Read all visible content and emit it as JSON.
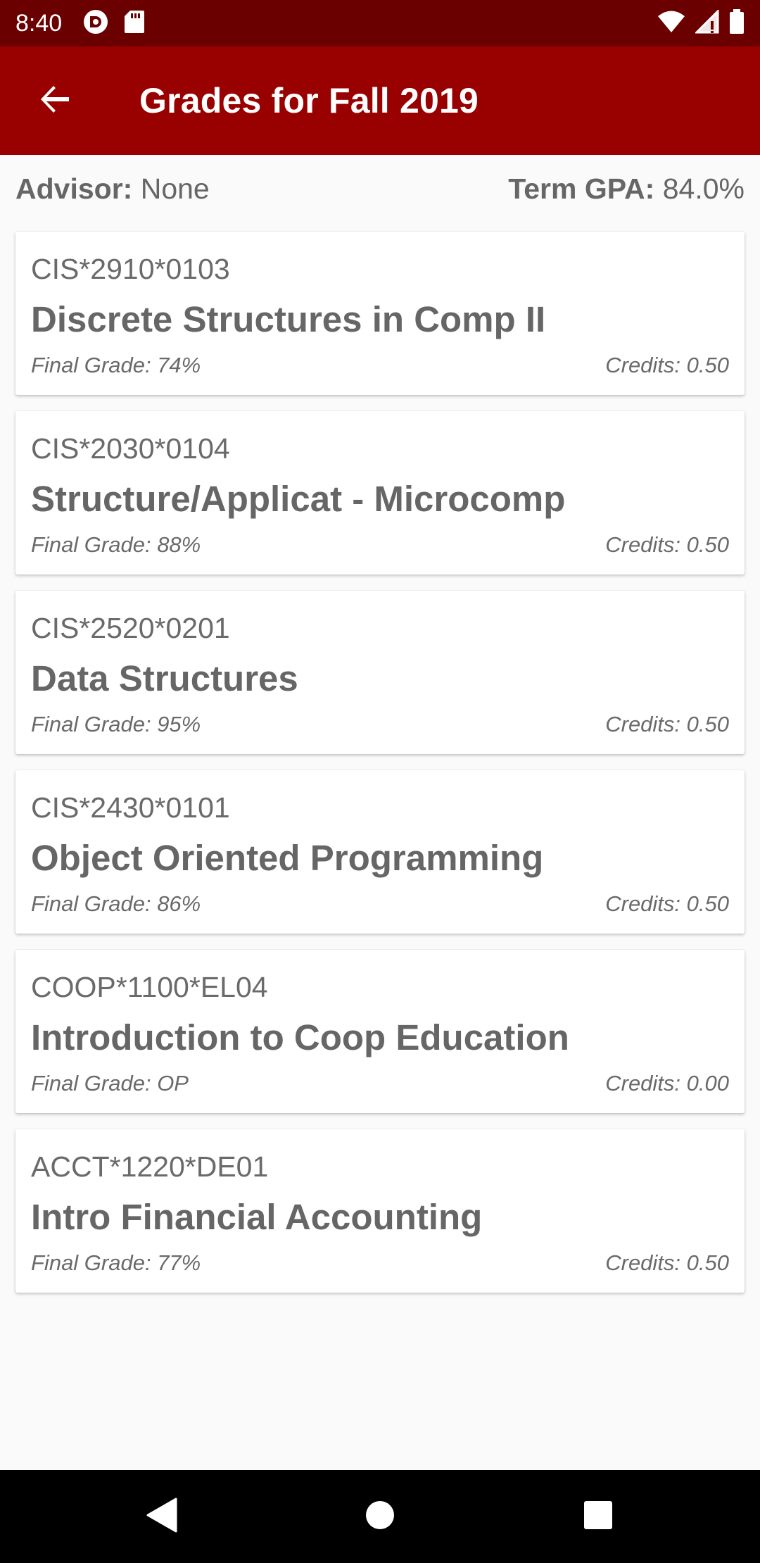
{
  "status_bar": {
    "time": "8:40",
    "left_icons": [
      "pocket-casts-icon",
      "sd-card-icon"
    ],
    "right_icons": [
      "wifi-icon",
      "cell-signal-icon",
      "battery-icon"
    ]
  },
  "app_bar": {
    "title": "Grades for Fall 2019",
    "back_icon": "arrow-left-icon",
    "color": "#990000"
  },
  "summary": {
    "advisor_label": "Advisor:",
    "advisor_value": "None",
    "gpa_label": "Term GPA:",
    "gpa_value": "84.0%"
  },
  "courses": [
    {
      "code": "CIS*2910*0103",
      "name": "Discrete Structures in Comp II",
      "grade": "Final Grade: 74%",
      "credits": "Credits: 0.50"
    },
    {
      "code": "CIS*2030*0104",
      "name": "Structure/Applicat - Microcomp",
      "grade": "Final Grade: 88%",
      "credits": "Credits: 0.50"
    },
    {
      "code": "CIS*2520*0201",
      "name": "Data Structures",
      "grade": "Final Grade: 95%",
      "credits": "Credits: 0.50"
    },
    {
      "code": "CIS*2430*0101",
      "name": "Object Oriented Programming",
      "grade": "Final Grade: 86%",
      "credits": "Credits: 0.50"
    },
    {
      "code": "COOP*1100*EL04",
      "name": "Introduction to Coop Education",
      "grade": "Final Grade: OP",
      "credits": "Credits: 0.00"
    },
    {
      "code": "ACCT*1220*DE01",
      "name": "Intro Financial Accounting",
      "grade": "Final Grade: 77%",
      "credits": "Credits: 0.50"
    }
  ],
  "nav_bar": {
    "icons": [
      "nav-back-icon",
      "nav-home-icon",
      "nav-recents-icon"
    ]
  }
}
